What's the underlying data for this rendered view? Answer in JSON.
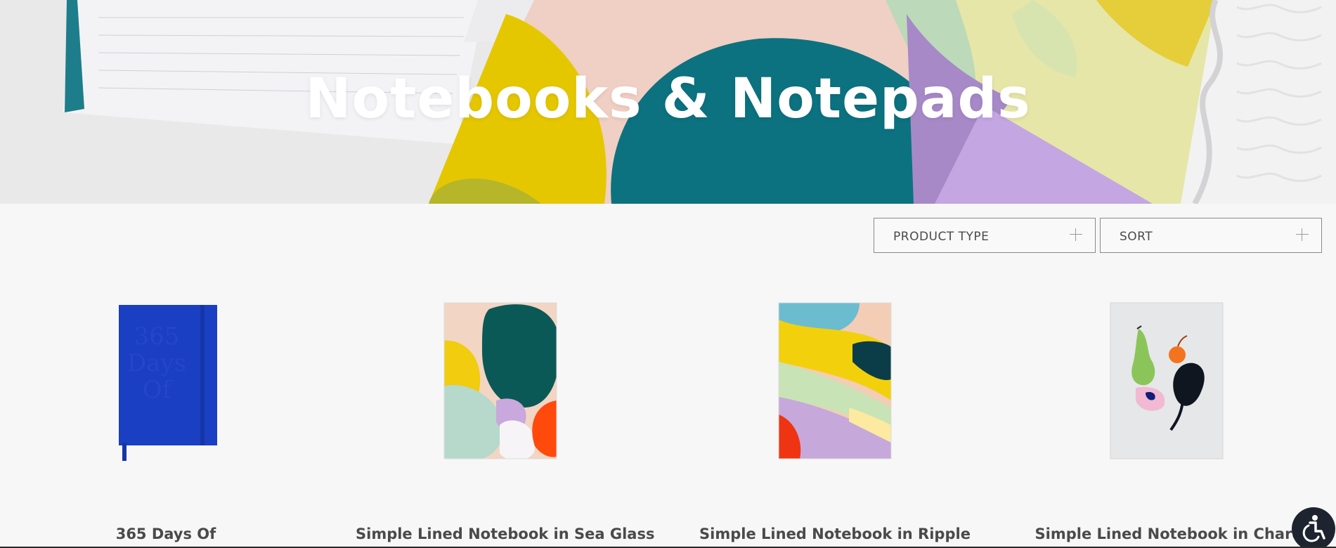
{
  "hero": {
    "title": "Notebooks & Notepads"
  },
  "filters": {
    "product_type": {
      "label": "PRODUCT TYPE"
    },
    "sort": {
      "label": "SORT"
    }
  },
  "products": [
    {
      "name": "365 Days Of",
      "cover_text": [
        "365",
        "Days",
        "Of"
      ],
      "cover_color": "#1a3fc2"
    },
    {
      "name": "Simple Lined Notebook in Sea Glass"
    },
    {
      "name": "Simple Lined Notebook in Ripple"
    },
    {
      "name": "Simple Lined Notebook in Chard"
    }
  ],
  "colors": {
    "accent_teal": "#0e7280",
    "accent_yellow": "#e6c800",
    "accent_lilac": "#b89ad8",
    "text": "#4a4a4a"
  },
  "accessibility": {
    "icon": "accessibility-icon"
  }
}
